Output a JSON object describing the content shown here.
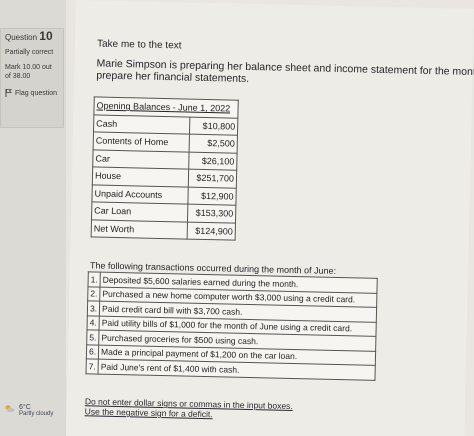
{
  "question": {
    "label": "Question",
    "number": "10",
    "status": "Partially correct",
    "mark": "Mark 10.00 out of 38.00",
    "flag_label": "Flag question"
  },
  "main": {
    "link": "Take me to the text",
    "intro": "Marie Simpson is preparing her balance sheet and income statement for the mont prepare her financial statements."
  },
  "balances": {
    "title": "Opening Balances - June 1, 2022",
    "rows": [
      {
        "label": "Cash",
        "value": "$10,800"
      },
      {
        "label": "Contents of Home",
        "value": "$2,500"
      },
      {
        "label": "Car",
        "value": "$26,100"
      },
      {
        "label": "House",
        "value": "$251,700"
      },
      {
        "label": "Unpaid Accounts",
        "value": "$12,900"
      },
      {
        "label": "Car Loan",
        "value": "$153,300"
      },
      {
        "label": "Net Worth",
        "value": "$124,900"
      }
    ]
  },
  "transactions": {
    "title": "The following transactions occurred during the month of June:",
    "items": [
      {
        "n": "1.",
        "text": "Deposited $5,600 salaries earned during the month."
      },
      {
        "n": "2.",
        "text": "Purchased a new home computer worth $3,000 using a credit card."
      },
      {
        "n": "3.",
        "text": "Paid credit card bill with $3,700 cash."
      },
      {
        "n": "4.",
        "text": "Paid utility bills of $1,000 for the month of June using a credit card."
      },
      {
        "n": "5.",
        "text": "Purchased groceries for $500 using cash."
      },
      {
        "n": "6.",
        "text": "Made a principal payment of $1,200 on the car loan."
      },
      {
        "n": "7.",
        "text": "Paid June's rent of $1,400 with cash."
      }
    ]
  },
  "notes": {
    "line1": "Do not enter dollar signs or commas in the input boxes.",
    "line2": "Use the negative sign for a deficit."
  },
  "weather": {
    "temp": "6°C",
    "desc": "Partly cloudy",
    "icon": "partly-cloudy-icon"
  }
}
